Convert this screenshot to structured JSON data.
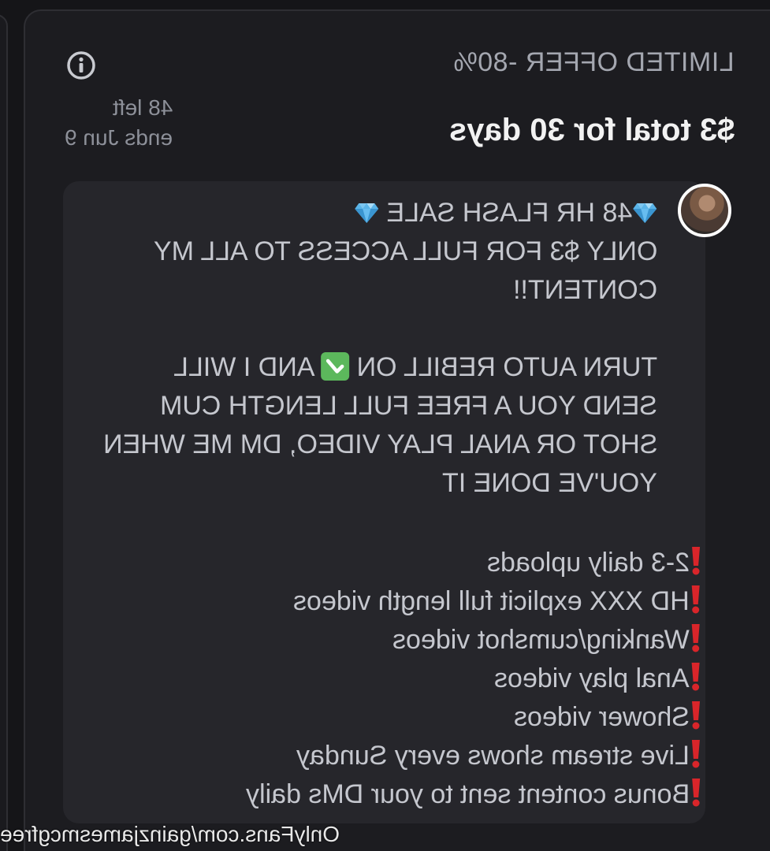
{
  "offer": {
    "title": "LIMITED OFFER -80%",
    "price": "$3 total for 30 days",
    "left": "48 left",
    "ends": "ends Jun 9"
  },
  "message": {
    "line1": "48 HR FLASH SALE ",
    "line2": "ONLY $3 FOR FULL ACCESS TO ALL MY",
    "line3": "CONTENT!!",
    "line4a": "TURN AUTO REBILL ON ",
    "line4b": " AND I WILL",
    "line5": "SEND YOU A FREE FULL LENGTH CUM",
    "line6": "SHOT OR ANAL PLAY VIDEO, DM ME WHEN",
    "line7": "YOU'VE DONE IT"
  },
  "bullets": [
    "2-3 daily uploads",
    "HD XXX explicit full length videos",
    "Wanking/cumshot videos",
    "Anal play videos",
    "Shower videos",
    "Live stream shows every Sunday",
    "Bonus content sent to your DMs daily"
  ],
  "watermark": "OnlyFans.com/gainzjamesmcgfree",
  "icons": {
    "info": "info-icon",
    "diamond": "gem-icon",
    "check": "check-mark-button-icon",
    "bang": "exclamation-icon"
  },
  "colors": {
    "background": "#151518",
    "card": "#1c1c20",
    "bubble": "#26262b",
    "diamond": "#5ab4e8",
    "check": "#5cb85c",
    "bang": "#d9252a"
  }
}
